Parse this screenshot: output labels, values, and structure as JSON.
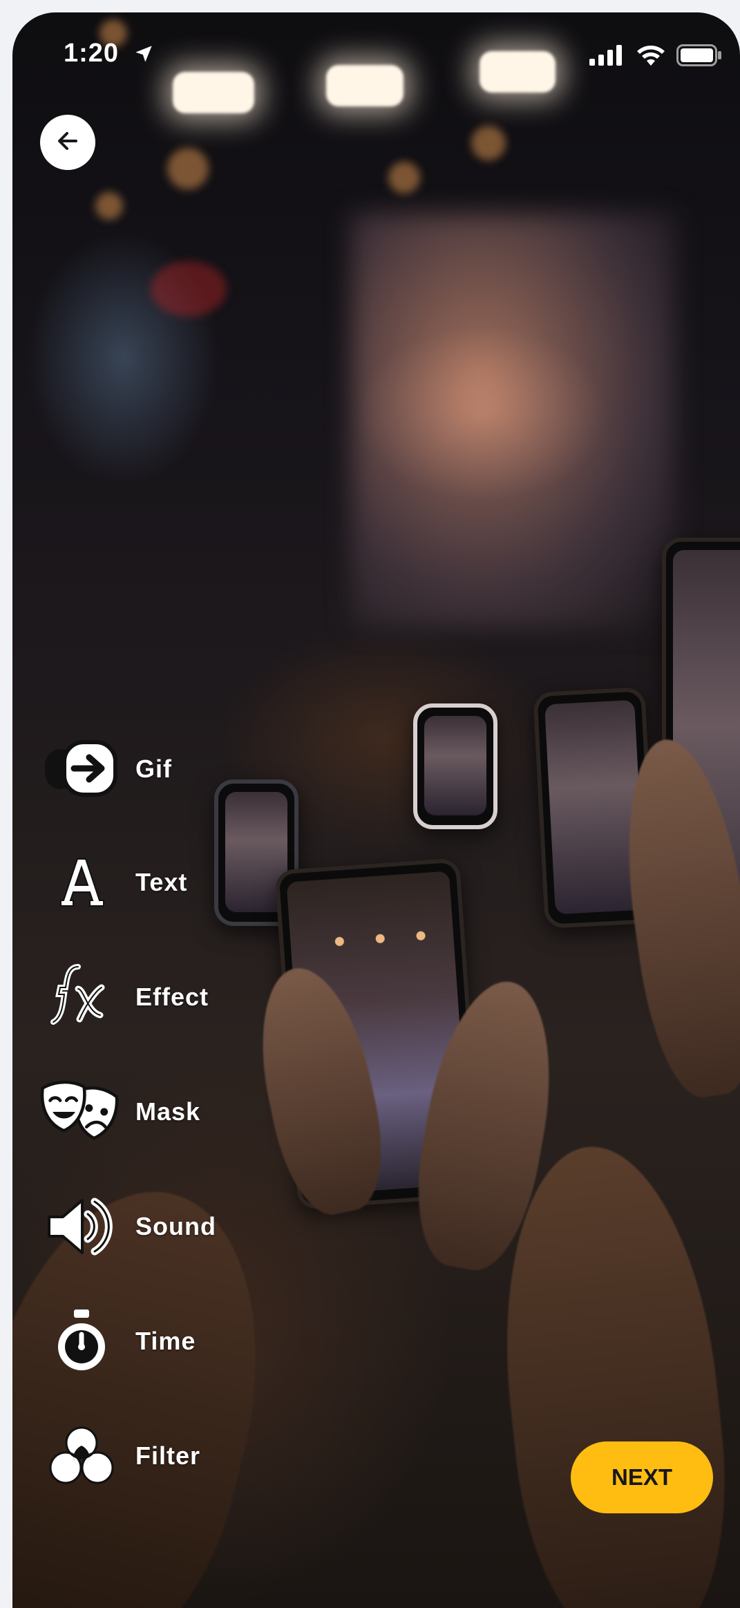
{
  "status_bar": {
    "time": "1:20",
    "location_icon": "location-arrow-icon",
    "signal_icon": "cellular-signal-icon",
    "wifi_icon": "wifi-icon",
    "battery_icon": "battery-icon"
  },
  "navigation": {
    "back_icon": "arrow-left-icon"
  },
  "tools": [
    {
      "label": "Gif",
      "icon": "gif-icon"
    },
    {
      "label": "Text",
      "icon": "text-icon"
    },
    {
      "label": "Effect",
      "icon": "fx-icon"
    },
    {
      "label": "Mask",
      "icon": "theater-masks-icon"
    },
    {
      "label": "Sound",
      "icon": "speaker-icon"
    },
    {
      "label": "Time",
      "icon": "stopwatch-icon"
    },
    {
      "label": "Filter",
      "icon": "filter-circles-icon"
    }
  ],
  "actions": {
    "next_label": "NEXT"
  },
  "colors": {
    "accent": "#FFBD12",
    "foreground": "#FFFFFF",
    "button_text": "#18171D",
    "page_background": "#F1F2F5"
  }
}
